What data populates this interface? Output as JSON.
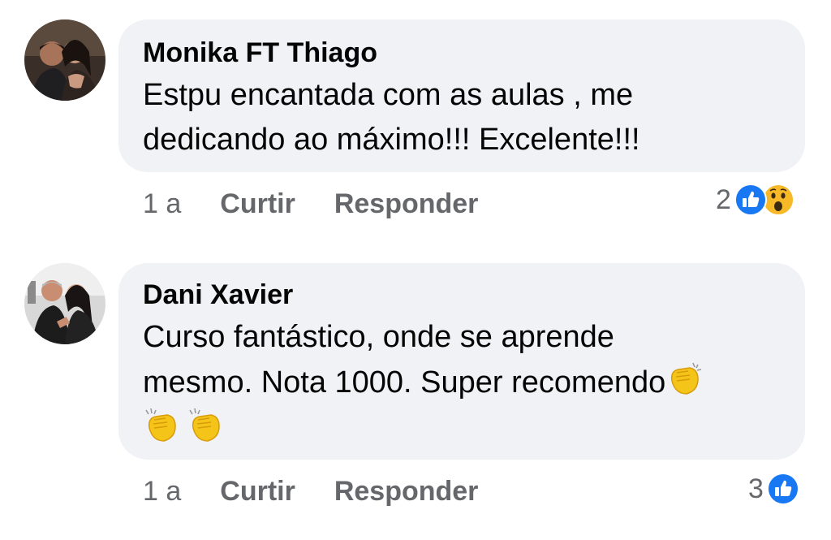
{
  "comments": [
    {
      "author": "Monika FT Thiago",
      "text_lines": [
        "Estpu encantada com as aulas , me",
        "dedicando ao máximo!!! Excelente!!!"
      ],
      "time": "1 a",
      "like_label": "Curtir",
      "reply_label": "Responder",
      "reaction_count": "2",
      "reactions": [
        "like-icon",
        "wow-icon"
      ]
    },
    {
      "author": "Dani Xavier",
      "text_lines": [
        "Curso fantástico, onde se aprende",
        "mesmo. Nota 1000. Super recomendo"
      ],
      "emoji_line": [
        "clapping-hands-icon",
        "clapping-hands-icon",
        "clapping-hands-icon"
      ],
      "time": "1 a",
      "like_label": "Curtir",
      "reply_label": "Responder",
      "reaction_count": "3",
      "reactions": [
        "like-icon"
      ]
    }
  ],
  "colors": {
    "bubble": "#f0f2f5",
    "meta_text": "#65676b",
    "like_blue": "#1877f2",
    "wow_yellow": "#f7b928"
  }
}
